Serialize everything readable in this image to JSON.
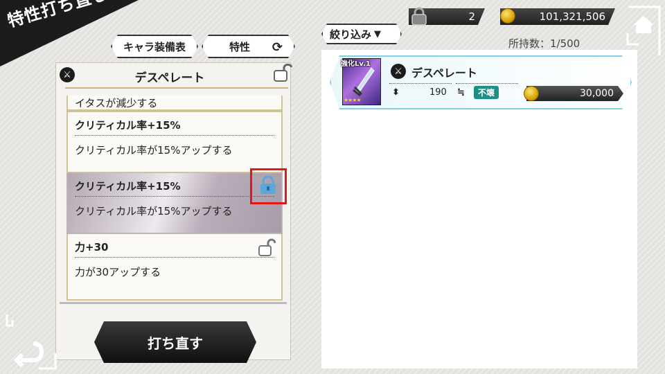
{
  "screen": {
    "title": "特性打ち直し"
  },
  "tabs": [
    {
      "label": "キャラ装備表"
    },
    {
      "label": "特性"
    }
  ],
  "weapon": {
    "name": "デスペレート"
  },
  "traits": [
    {
      "name": "",
      "description": "イタスが減少する",
      "locked": false
    },
    {
      "name": "クリティカル率+15%",
      "description": "クリティカル率が15%アップする",
      "locked": false
    },
    {
      "name": "クリティカル率+15%",
      "description": "クリティカル率が15%アップする",
      "locked": true,
      "selected": true
    },
    {
      "name": "力+30",
      "description": "力が30アップする",
      "locked": false
    }
  ],
  "reroll_button": {
    "label": "打ち直す"
  },
  "currency": {
    "keys": "2",
    "gold": "101,321,506"
  },
  "filter": {
    "label": "絞り込み"
  },
  "owned": {
    "text": "所持数：1/500"
  },
  "item_card": {
    "enhance_label": "強化Lv.1",
    "stars": "★★★★",
    "name": "デスペレート",
    "attack": "190",
    "durability_label": "不壊",
    "price": "30,000"
  },
  "colors": {
    "accent_cyan": "#7fd0e6",
    "highlight_red": "#e21818",
    "lock_active": "#5aa8d8",
    "durability_green": "#1e8f86"
  }
}
